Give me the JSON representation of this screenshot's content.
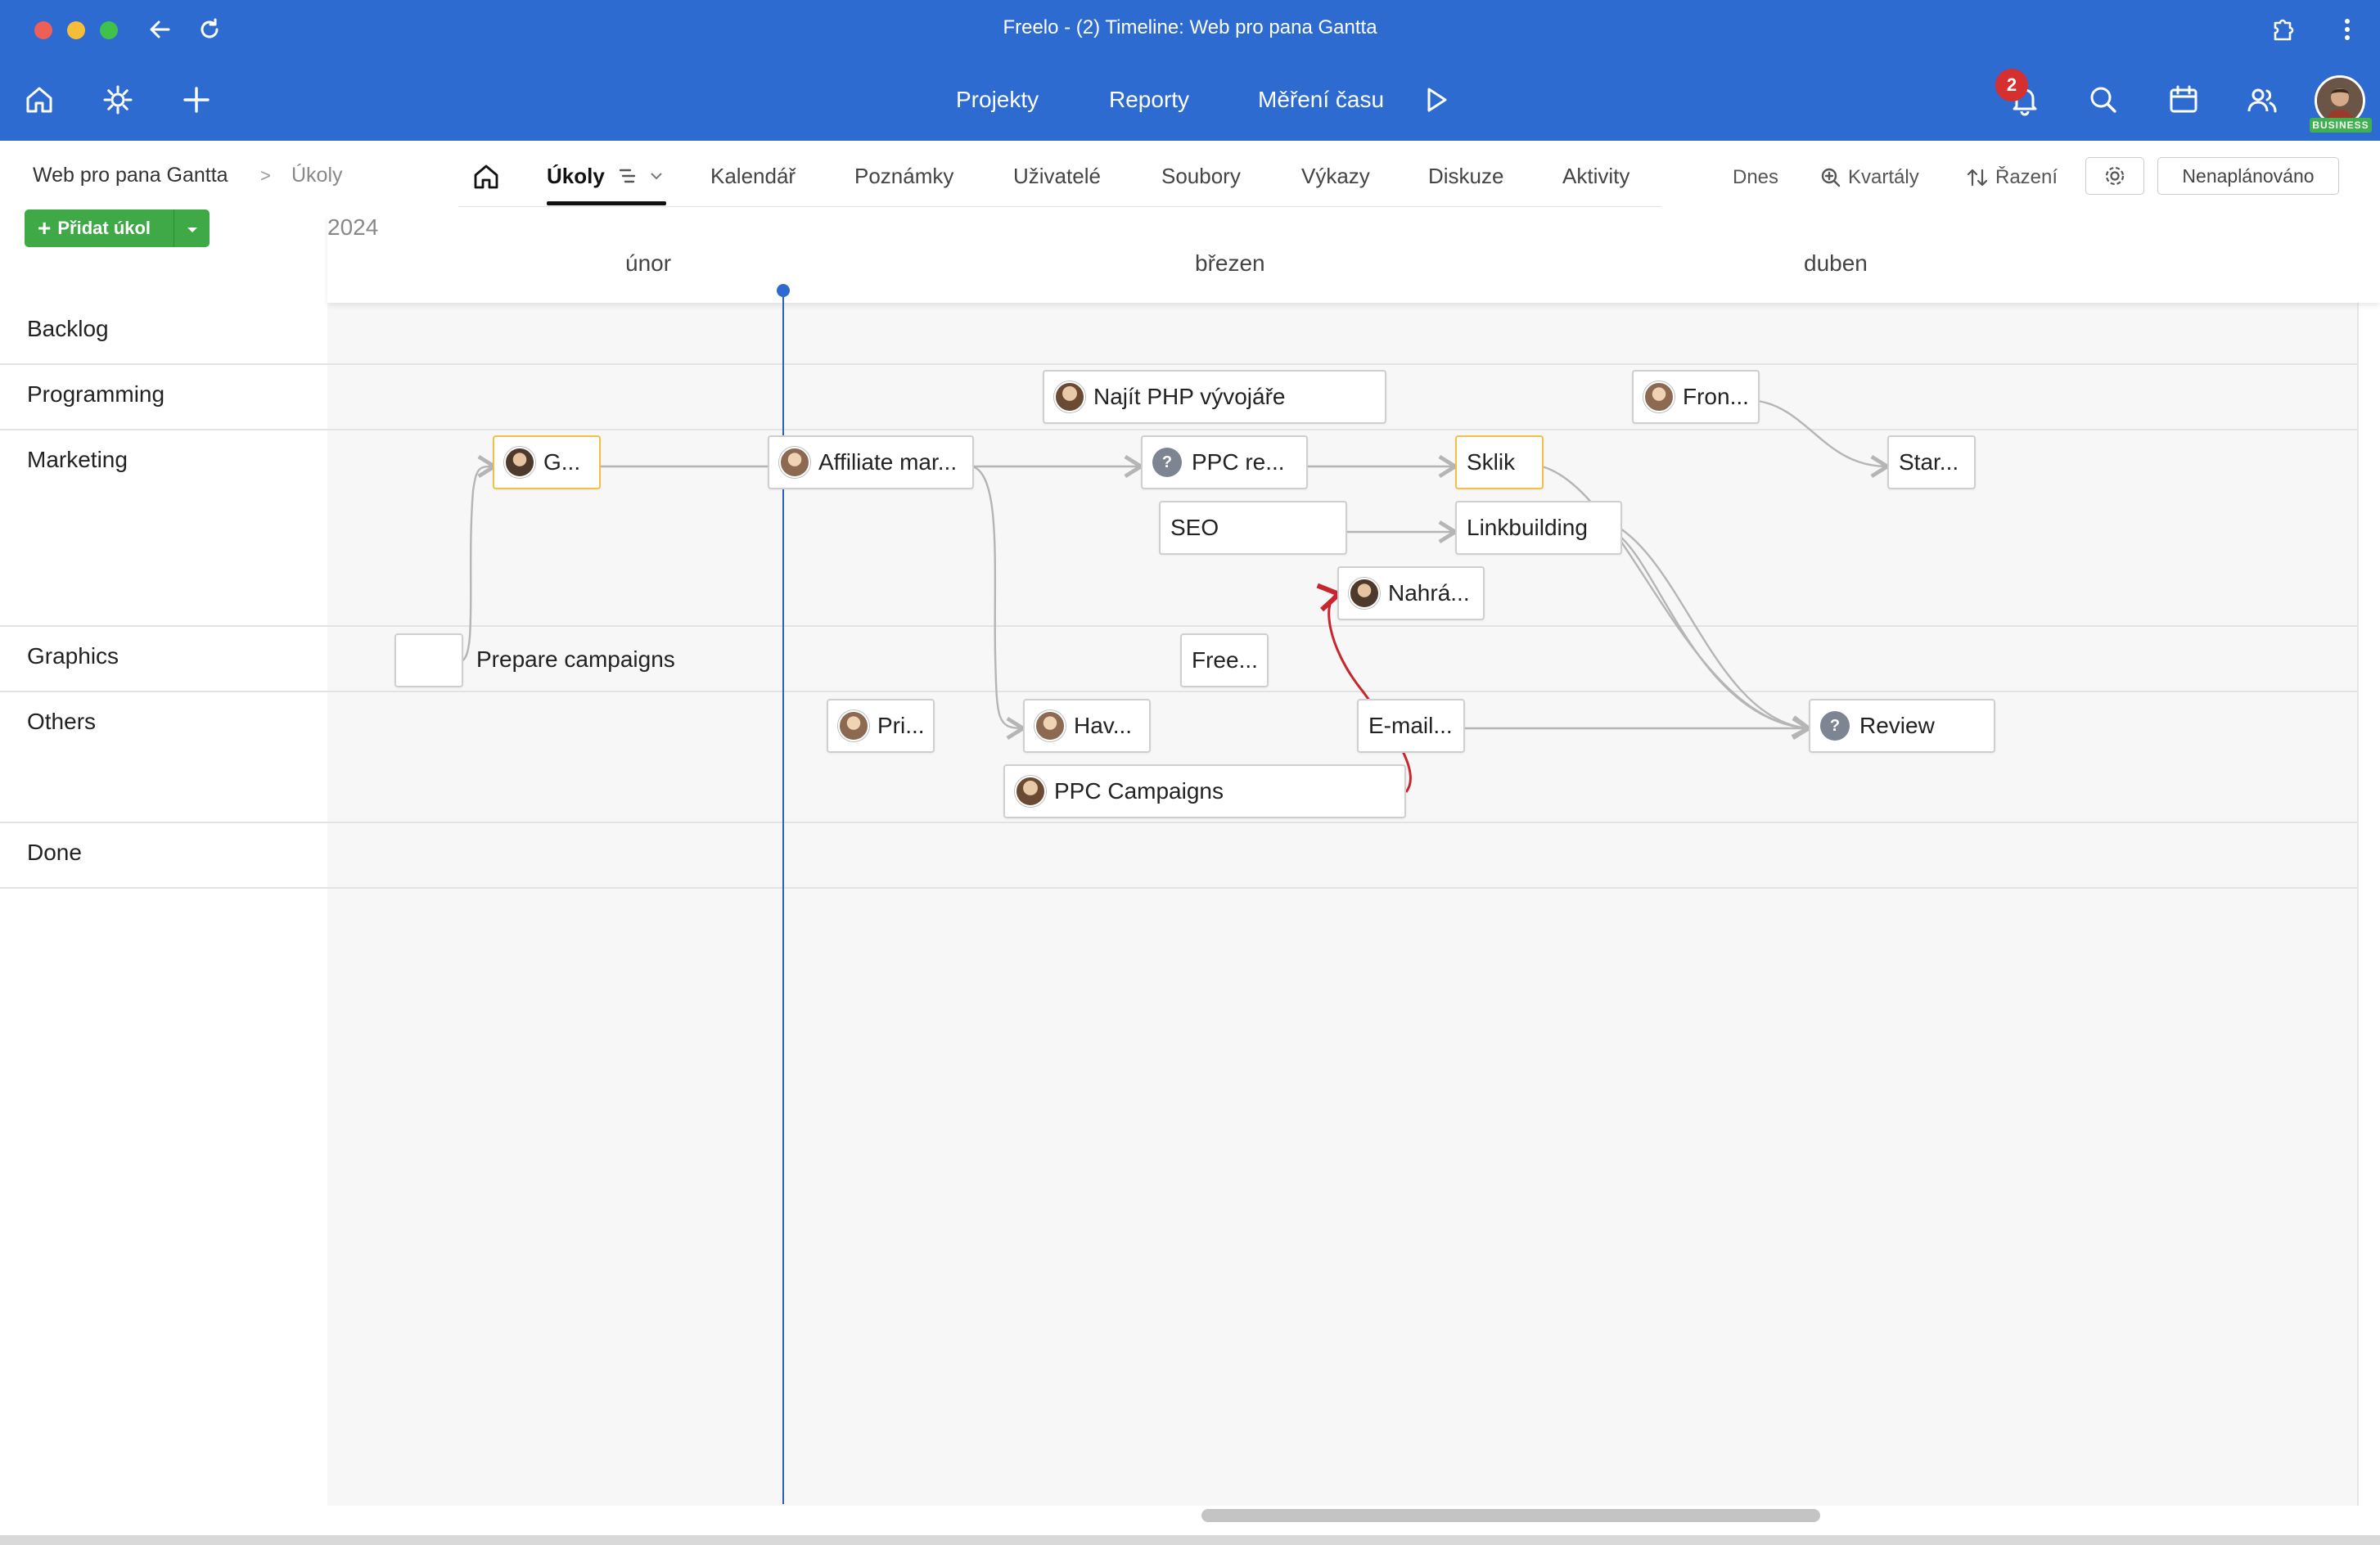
{
  "window": {
    "title": "Freelo - (2) Timeline: Web pro pana Gantta",
    "colors": {
      "header": "#2d6bd0",
      "close": "#ee5f57",
      "minimize": "#f6bd3b",
      "zoom": "#3fc14c"
    }
  },
  "topnav": {
    "items": [
      "Projekty",
      "Reporty",
      "Měření času"
    ],
    "notifications_count": "2",
    "badge": "BUSINESS"
  },
  "breadcrumb": {
    "project": "Web pro pana Gantta",
    "separator": ">",
    "current": "Úkoly"
  },
  "add_task_label": "Přidat úkol",
  "tabs": [
    "Úkoly",
    "Kalendář",
    "Poznámky",
    "Uživatelé",
    "Soubory",
    "Výkazy",
    "Diskuze",
    "Aktivity"
  ],
  "toolbar": {
    "today": "Dnes",
    "zoom": "Kvartály",
    "sort": "Řazení",
    "unscheduled": "Nenaplánováno"
  },
  "timeline": {
    "year": "2024",
    "months": [
      "únor",
      "březen",
      "duben"
    ],
    "rows": [
      "Backlog",
      "Programming",
      "Marketing",
      "Graphics",
      "Others",
      "Done"
    ]
  },
  "tasks": [
    {
      "label": "Najít PHP vývojáře",
      "avatar": "avatar-man"
    },
    {
      "label": "Fron...",
      "avatar": "avatar-woman"
    },
    {
      "label": "G...",
      "avatar": "avatar-man-2",
      "highlight": true
    },
    {
      "label": "Affiliate mar...",
      "avatar": "avatar-woman"
    },
    {
      "label": "PPC re...",
      "avatar": "unknown"
    },
    {
      "label": "Sklik",
      "highlight": true
    },
    {
      "label": "Star..."
    },
    {
      "label": "SEO"
    },
    {
      "label": "Linkbuilding"
    },
    {
      "label": "Nahrá...",
      "avatar": "avatar-woman-2"
    },
    {
      "label": "Prepare campaigns"
    },
    {
      "label": "Free..."
    },
    {
      "label": "Pri...",
      "avatar": "avatar-woman"
    },
    {
      "label": "Hav...",
      "avatar": "avatar-woman"
    },
    {
      "label": "E-mail..."
    },
    {
      "label": "Review",
      "avatar": "unknown"
    },
    {
      "label": "PPC Campaigns",
      "avatar": "avatar-man"
    }
  ],
  "unknown_avatar_symbol": "?",
  "accent_colors": {
    "today_line": "#2d5fb8",
    "highlight_border": "#efc14b",
    "conflict_edge": "#c8252c",
    "edge": "#b5b5b5"
  }
}
